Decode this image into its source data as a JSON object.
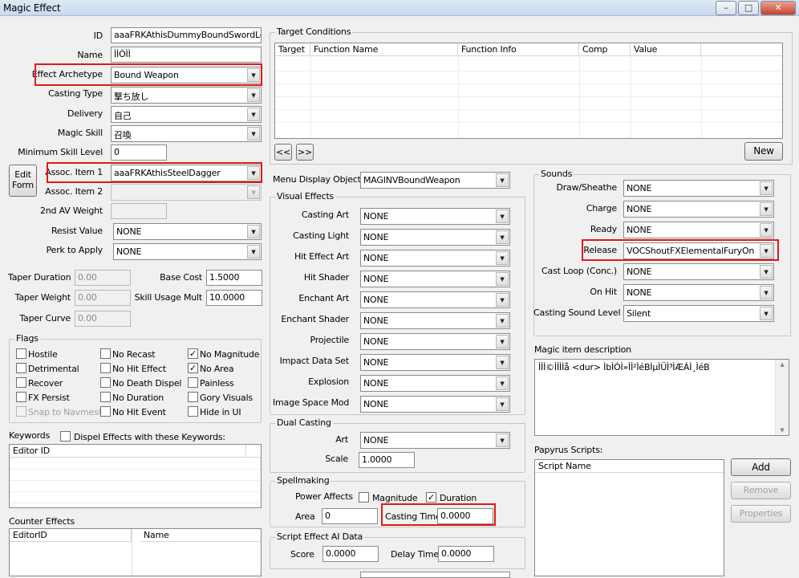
{
  "window": {
    "title": "Magic Effect",
    "minimize": "–",
    "maximize": "□",
    "close": "✕"
  },
  "basic": {
    "id_label": "ID",
    "id_value": "aaaFRKAthisDummyBoundSwordLeftH",
    "name_label": "Name",
    "name_value": "ÌÌÒÌÌ",
    "archetype_label": "Effect Archetype",
    "archetype_value": "Bound Weapon",
    "casting_type_label": "Casting Type",
    "casting_type_value": "撃ち放し",
    "delivery_label": "Delivery",
    "delivery_value": "自己",
    "magic_skill_label": "Magic Skill",
    "magic_skill_value": "召喚",
    "min_skill_label": "Minimum Skill Level",
    "min_skill_value": "0",
    "edit_form_line1": "Edit",
    "edit_form_line2": "Form",
    "assoc1_label": "Assoc. Item 1",
    "assoc1_value": "aaaFRKAthisSteelDagger",
    "assoc2_label": "Assoc. Item 2",
    "assoc2_value": "",
    "second_av_label": "2nd AV Weight",
    "second_av_value": "",
    "resist_label": "Resist Value",
    "resist_value": "NONE",
    "perk_label": "Perk to Apply",
    "perk_value": "NONE"
  },
  "taper": {
    "duration_label": "Taper Duration",
    "duration_value": "0.00",
    "weight_label": "Taper Weight",
    "weight_value": "0.00",
    "curve_label": "Taper Curve",
    "curve_value": "0.00",
    "base_cost_label": "Base Cost",
    "base_cost_value": "1.5000",
    "skill_usage_label": "Skill Usage Mult",
    "skill_usage_value": "10.0000"
  },
  "flags": {
    "title": "Flags",
    "items": [
      {
        "label": "Hostile",
        "checked": false,
        "disabled": false
      },
      {
        "label": "No Recast",
        "checked": false,
        "disabled": false
      },
      {
        "label": "No Magnitude",
        "checked": true,
        "disabled": false
      },
      {
        "label": "Detrimental",
        "checked": false,
        "disabled": false
      },
      {
        "label": "No Hit Effect",
        "checked": false,
        "disabled": false
      },
      {
        "label": "No Area",
        "checked": true,
        "disabled": false
      },
      {
        "label": "Recover",
        "checked": false,
        "disabled": false
      },
      {
        "label": "No Death Dispel",
        "checked": false,
        "disabled": false
      },
      {
        "label": "Painless",
        "checked": false,
        "disabled": false
      },
      {
        "label": "FX Persist",
        "checked": false,
        "disabled": false
      },
      {
        "label": "No Duration",
        "checked": false,
        "disabled": false
      },
      {
        "label": "Gory Visuals",
        "checked": false,
        "disabled": false
      },
      {
        "label": "Snap to Navmesh",
        "checked": false,
        "disabled": true
      },
      {
        "label": "No Hit Event",
        "checked": false,
        "disabled": false
      },
      {
        "label": "Hide in UI",
        "checked": false,
        "disabled": false
      }
    ]
  },
  "keywords": {
    "title": "Keywords",
    "dispel_label": "Dispel Effects with these Keywords:",
    "column": "Editor ID"
  },
  "counter": {
    "title": "Counter Effects",
    "col1": "EditorID",
    "col2": "Name"
  },
  "target": {
    "title": "Target Conditions",
    "columns": [
      "Target",
      "Function Name",
      "Function Info",
      "Comp",
      "Value"
    ],
    "prev": "<<",
    "next": ">>",
    "new_button": "New"
  },
  "menu_display": {
    "label": "Menu Display Object",
    "value": "MAGINVBoundWeapon"
  },
  "visual": {
    "title": "Visual Effects",
    "rows": [
      {
        "label": "Casting Art",
        "value": "NONE"
      },
      {
        "label": "Casting Light",
        "value": "NONE"
      },
      {
        "label": "Hit Effect Art",
        "value": "NONE"
      },
      {
        "label": "Hit Shader",
        "value": "NONE"
      },
      {
        "label": "Enchant Art",
        "value": "NONE"
      },
      {
        "label": "Enchant Shader",
        "value": "NONE"
      },
      {
        "label": "Projectile",
        "value": "NONE"
      },
      {
        "label": "Impact Data Set",
        "value": "NONE"
      },
      {
        "label": "Explosion",
        "value": "NONE"
      },
      {
        "label": "Image Space Mod",
        "value": "NONE"
      }
    ]
  },
  "dual": {
    "title": "Dual Casting",
    "art_label": "Art",
    "art_value": "NONE",
    "scale_label": "Scale",
    "scale_value": "1.0000"
  },
  "spellmaking": {
    "title": "Spellmaking",
    "power_label": "Power Affects",
    "magnitude_label": "Magnitude",
    "magnitude_checked": false,
    "duration_label": "Duration",
    "duration_checked": true,
    "area_label": "Area",
    "area_value": "0",
    "casting_time_label": "Casting Time",
    "casting_time_value": "0.0000"
  },
  "ai": {
    "title": "Script Effect AI Data",
    "score_label": "Score",
    "score_value": "0.0000",
    "delay_label": "Delay Time",
    "delay_value": "0.0000"
  },
  "sounds": {
    "title": "Sounds",
    "rows": [
      {
        "label": "Draw/Sheathe",
        "value": "NONE"
      },
      {
        "label": "Charge",
        "value": "NONE"
      },
      {
        "label": "Ready",
        "value": "NONE"
      },
      {
        "label": "Release",
        "value": "VOCShoutFXElementalFuryOn"
      },
      {
        "label": "Cast Loop (Conc.)",
        "value": "NONE"
      },
      {
        "label": "On Hit",
        "value": "NONE"
      }
    ],
    "level_label": "Casting Sound Level",
    "level_value": "Silent"
  },
  "description": {
    "title": "Magic item description",
    "text": "ÌÌÌ©ÌÌÌÌå <dur> ÌbÌÓÌ»ÌÌ²ÌéBÌµÌÜÌ³ÌÆÁÌ¸ÌéB"
  },
  "papyrus": {
    "title": "Papyrus Scripts:",
    "column": "Script Name",
    "add": "Add",
    "remove": "Remove",
    "properties": "Properties"
  },
  "highlight_color": "#e01919"
}
